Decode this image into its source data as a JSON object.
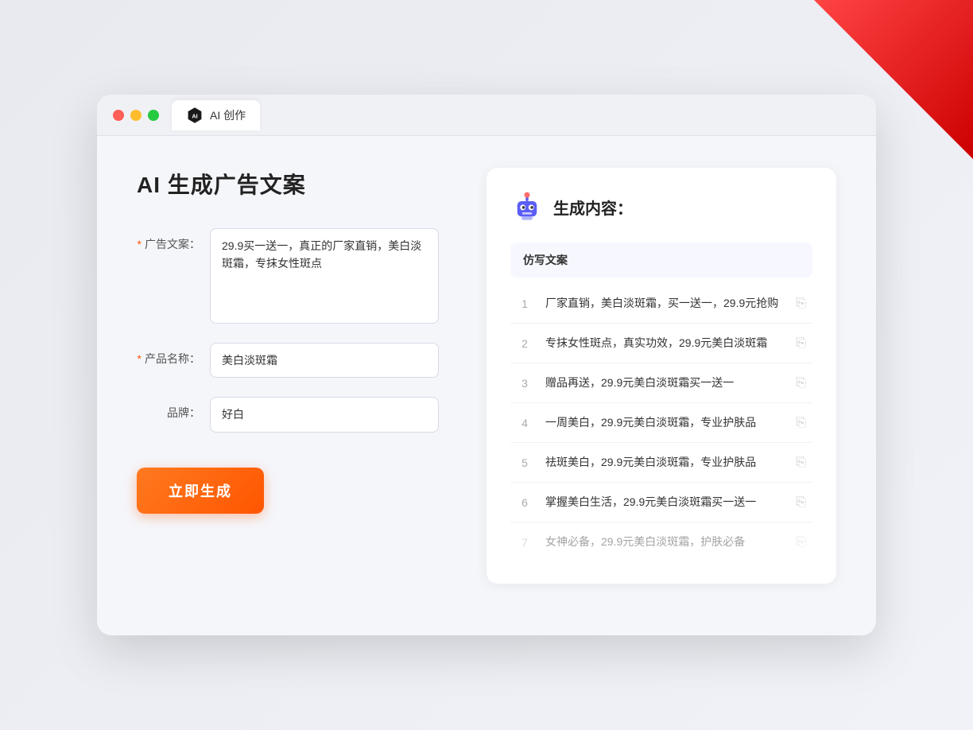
{
  "window": {
    "tab_label": "AI 创作"
  },
  "left": {
    "title": "AI 生成广告文案",
    "fields": [
      {
        "label": "广告文案：",
        "required": true,
        "type": "textarea",
        "value": "29.9买一送一，真正的厂家直销，美白淡斑霜，专抹女性斑点",
        "name": "ad-copy-textarea"
      },
      {
        "label": "产品名称：",
        "required": true,
        "type": "input",
        "value": "美白淡斑霜",
        "name": "product-name-input"
      },
      {
        "label": "品牌：",
        "required": false,
        "type": "input",
        "value": "好白",
        "name": "brand-input"
      }
    ],
    "button_label": "立即生成"
  },
  "right": {
    "title": "生成内容：",
    "table_header": "仿写文案",
    "items": [
      {
        "num": 1,
        "text": "厂家直销，美白淡斑霜，买一送一，29.9元抢购",
        "faded": false
      },
      {
        "num": 2,
        "text": "专抹女性斑点，真实功效，29.9元美白淡斑霜",
        "faded": false
      },
      {
        "num": 3,
        "text": "赠品再送，29.9元美白淡斑霜买一送一",
        "faded": false
      },
      {
        "num": 4,
        "text": "一周美白，29.9元美白淡斑霜，专业护肤品",
        "faded": false
      },
      {
        "num": 5,
        "text": "祛斑美白，29.9元美白淡斑霜，专业护肤品",
        "faded": false
      },
      {
        "num": 6,
        "text": "掌握美白生活，29.9元美白淡斑霜买一送一",
        "faded": false
      },
      {
        "num": 7,
        "text": "女神必备，29.9元美白淡斑霜，护肤必备",
        "faded": true
      }
    ]
  },
  "colors": {
    "accent": "#ff5500",
    "primary": "#6b7bff"
  }
}
